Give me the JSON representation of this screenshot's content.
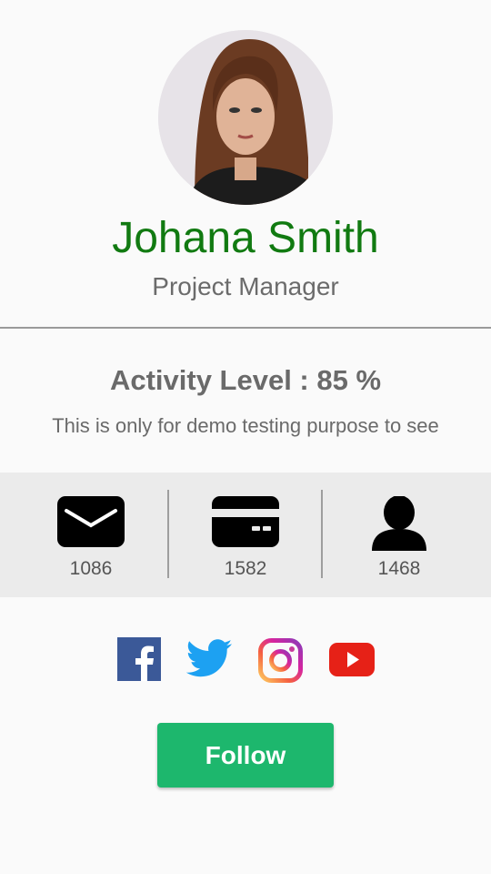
{
  "profile": {
    "name": "Johana Smith",
    "role": "Project Manager",
    "avatar_icon": "profile-photo"
  },
  "activity": {
    "heading": "Activity Level : 85 %",
    "level_percent": 85,
    "description": "This is only for demo testing purpose to see"
  },
  "stats": [
    {
      "icon": "mail-icon",
      "value": "1086"
    },
    {
      "icon": "card-icon",
      "value": "1582"
    },
    {
      "icon": "person-icon",
      "value": "1468"
    }
  ],
  "social": [
    {
      "icon": "facebook-icon",
      "color": "#3b5998"
    },
    {
      "icon": "twitter-icon",
      "color": "#1da1f2"
    },
    {
      "icon": "instagram-icon",
      "color": "#d6249f"
    },
    {
      "icon": "youtube-icon",
      "color": "#e62117"
    }
  ],
  "actions": {
    "follow_label": "Follow",
    "follow_color": "#1db76d"
  },
  "colors": {
    "name": "#117a11",
    "stats_band": "#ebebeb",
    "background": "#fafafa"
  }
}
